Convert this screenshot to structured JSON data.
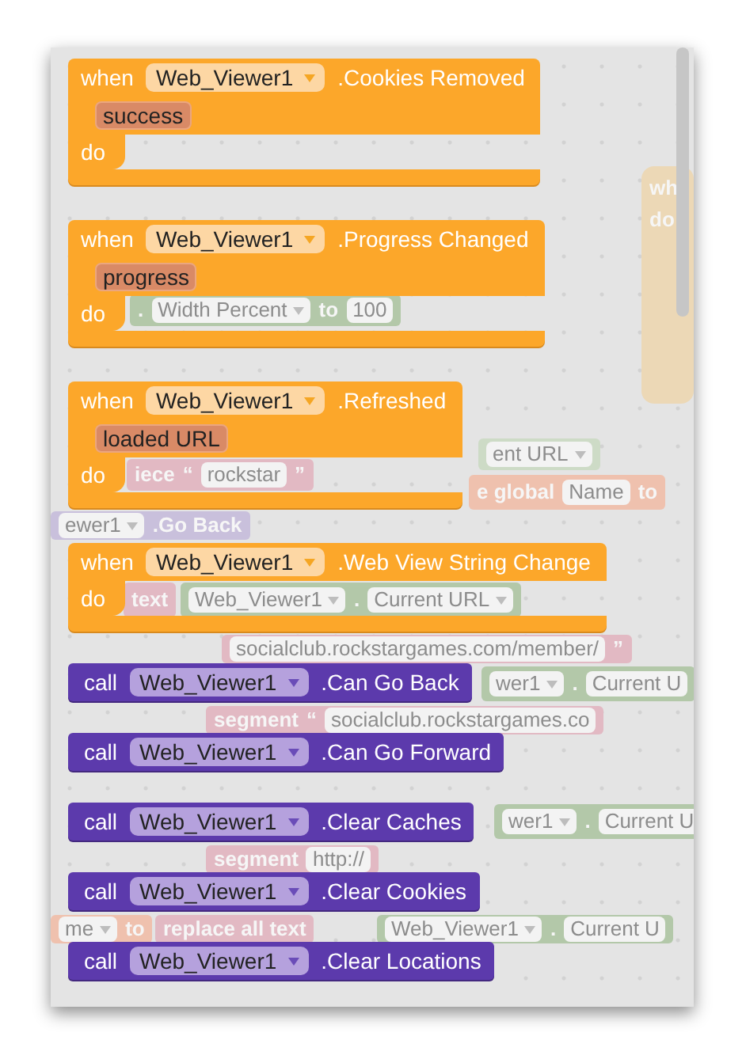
{
  "event_blocks": [
    {
      "keyword_when": "when",
      "component": "Web_Viewer1",
      "event": ".Cookies Removed",
      "parameters": [
        "success"
      ],
      "keyword_do": "do"
    },
    {
      "keyword_when": "when",
      "component": "Web_Viewer1",
      "event": ".Progress Changed",
      "parameters": [
        "progress"
      ],
      "keyword_do": "do"
    },
    {
      "keyword_when": "when",
      "component": "Web_Viewer1",
      "event": ".Refreshed",
      "parameters": [
        "loaded URL"
      ],
      "keyword_do": "do"
    },
    {
      "keyword_when": "when",
      "component": "Web_Viewer1",
      "event": ".Web View String Change",
      "keyword_do": "do"
    }
  ],
  "call_blocks": [
    {
      "keyword": "call",
      "component": "Web_Viewer1",
      "method": ".Can Go Back"
    },
    {
      "keyword": "call",
      "component": "Web_Viewer1",
      "method": ".Can Go Forward"
    },
    {
      "keyword": "call",
      "component": "Web_Viewer1",
      "method": ".Clear Caches"
    },
    {
      "keyword": "call",
      "component": "Web_Viewer1",
      "method": ".Clear Cookies"
    },
    {
      "keyword": "call",
      "component": "Web_Viewer1",
      "method": ".Clear Locations"
    }
  ],
  "background_blocks": [
    {
      "color": "#b3c8a9",
      "items": [
        {
          "kind": "text",
          "text": "."
        },
        {
          "kind": "field",
          "text": "Width Percent",
          "dropdown": true
        },
        {
          "kind": "text",
          "text": "to"
        },
        {
          "kind": "field",
          "text": "100",
          "dropdown": false
        }
      ]
    },
    {
      "color": "#cddbc6",
      "items": [
        {
          "kind": "field",
          "text": "ent URL",
          "dropdown": true
        }
      ]
    },
    {
      "color": "#e2b9c3",
      "items": [
        {
          "kind": "text",
          "text": "iece"
        },
        {
          "kind": "text",
          "text": "“"
        },
        {
          "kind": "field",
          "text": "rockstar",
          "dropdown": false
        },
        {
          "kind": "text",
          "text": "”"
        }
      ]
    },
    {
      "color": "#efc1ae",
      "items": [
        {
          "kind": "text",
          "text": "e global"
        },
        {
          "kind": "field",
          "text": "Name",
          "dropdown": false
        },
        {
          "kind": "text",
          "text": "to"
        }
      ]
    },
    {
      "color": "#c9c0dc",
      "items": [
        {
          "kind": "field",
          "text": "ewer1",
          "dropdown": true
        },
        {
          "kind": "text",
          "text": ".Go Back"
        }
      ]
    },
    {
      "color": "#e2b9c3",
      "items": [
        {
          "kind": "text",
          "text": "text"
        }
      ]
    },
    {
      "color": "#b3c8a9",
      "items": [
        {
          "kind": "field",
          "text": "Web_Viewer1",
          "dropdown": true
        },
        {
          "kind": "text",
          "text": "."
        },
        {
          "kind": "field",
          "text": "Current URL",
          "dropdown": true
        }
      ]
    },
    {
      "color": "#e2b9c3",
      "items": [
        {
          "kind": "field",
          "text": "socialclub.rockstargames.com/member/",
          "dropdown": false
        },
        {
          "kind": "text",
          "text": "”"
        }
      ]
    },
    {
      "color": "#b3c8a9",
      "items": [
        {
          "kind": "field",
          "text": "wer1",
          "dropdown": true
        },
        {
          "kind": "text",
          "text": "."
        },
        {
          "kind": "field",
          "text": "Current U",
          "dropdown": false
        }
      ]
    },
    {
      "color": "#e2b9c3",
      "items": [
        {
          "kind": "text",
          "text": "segment"
        },
        {
          "kind": "text",
          "text": "“"
        },
        {
          "kind": "field",
          "text": "socialclub.rockstargames.co",
          "dropdown": false
        }
      ]
    },
    {
      "color": "#b3c8a9",
      "items": [
        {
          "kind": "field",
          "text": "wer1",
          "dropdown": true
        },
        {
          "kind": "text",
          "text": "."
        },
        {
          "kind": "field",
          "text": "Current U",
          "dropdown": false
        }
      ]
    },
    {
      "color": "#e2b9c3",
      "items": [
        {
          "kind": "text",
          "text": "segment"
        },
        {
          "kind": "field",
          "text": "http://",
          "dropdown": false
        }
      ]
    },
    {
      "color": "#efc1ae",
      "items": [
        {
          "kind": "field",
          "text": "me",
          "dropdown": true
        },
        {
          "kind": "text",
          "text": "to"
        }
      ]
    },
    {
      "color": "#e2b9c3",
      "items": [
        {
          "kind": "text",
          "text": "replace all text"
        }
      ]
    },
    {
      "color": "#b3c8a9",
      "items": [
        {
          "kind": "field",
          "text": "Web_Viewer1",
          "dropdown": true
        },
        {
          "kind": "text",
          "text": "."
        },
        {
          "kind": "field",
          "text": "Current U",
          "dropdown": false
        }
      ]
    },
    {
      "color": "#ecd8b6",
      "items": [
        {
          "kind": "text",
          "text": "wh"
        },
        {
          "kind": "text",
          "text": "do"
        }
      ]
    }
  ]
}
